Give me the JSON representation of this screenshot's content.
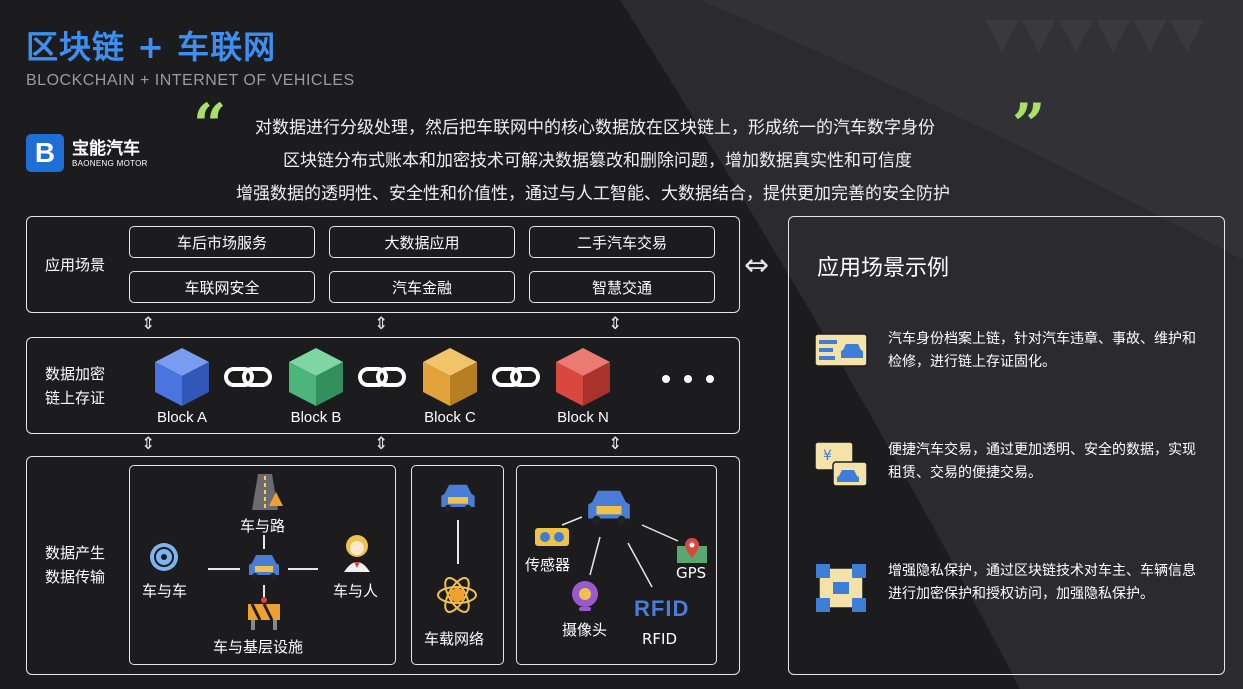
{
  "header": {
    "title": "区块链 + 车联网",
    "subtitle": "BLOCKCHAIN  +  INTERNET OF VEHICLES"
  },
  "logo": {
    "badge": "B",
    "name_cn": "宝能汽车",
    "name_en": "BAONENG MOTOR"
  },
  "quote": {
    "open": "“",
    "close": "”",
    "lines": [
      "对数据进行分级处理，然后把车联网中的核心数据放在区块链上，形成统一的汽车数字身份",
      "区块链分布式账本和加密技术可解决数据篡改和删除问题，增加数据真实性和可信度",
      "增强数据的透明性、安全性和价值性，通过与人工智能、大数据结合，提供更加完善的安全防护"
    ]
  },
  "rows": {
    "app_label": "应用场景",
    "chain_label_1": "数据加密",
    "chain_label_2": "链上存证",
    "data_label_1": "数据产生",
    "data_label_2": "数据传输"
  },
  "apps": [
    "车后市场服务",
    "大数据应用",
    "二手汽车交易",
    "车联网安全",
    "汽车金融",
    "智慧交通"
  ],
  "blocks": [
    {
      "label": "Block A",
      "color": "#4a74e0"
    },
    {
      "label": "Block B",
      "color": "#4cb57a"
    },
    {
      "label": "Block C",
      "color": "#e3a33a"
    },
    {
      "label": "Block N",
      "color": "#d9483f"
    }
  ],
  "arrows": {
    "vertical": "⇕",
    "bidirectional": "⇔"
  },
  "data_section": {
    "v2r": "车与路",
    "v2v": "车与车",
    "v2p": "车与人",
    "v2i": "车与基层设施",
    "network": "车载网络",
    "sensor": "传感器",
    "gps": "GPS",
    "camera": "摄像头",
    "rfid_logo": "RFID",
    "rfid": "RFID"
  },
  "right_panel": {
    "title": "应用场景示例",
    "examples": [
      "汽车身份档案上链，针对汽车违章、事故、维护和检修，进行链上存证固化。",
      "便捷汽车交易，通过更加透明、安全的数据，实现租赁、交易的便捷交易。",
      "增强隐私保护，通过区块链技术对车主、车辆信息进行加密保护和授权访问，加强隐私保护。"
    ]
  },
  "colors": {
    "title_blue": "#3d8ff0",
    "quote_green": "#a8e06a",
    "icon_gold": "#f0c24a",
    "icon_blue": "#3d7fd6"
  }
}
